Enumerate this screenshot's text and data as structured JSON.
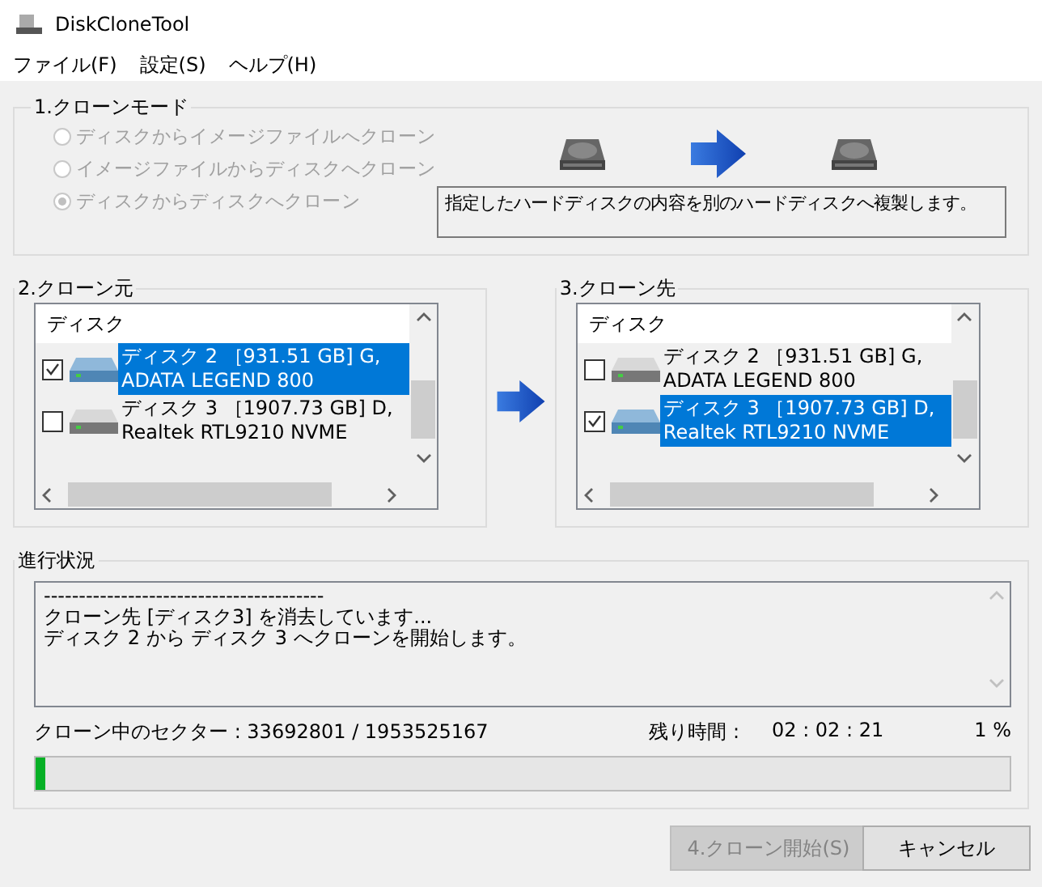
{
  "window": {
    "title": "DiskCloneTool"
  },
  "menu": [
    "ファイル(F)",
    "設定(S)",
    "ヘルプ(H)"
  ],
  "clone_mode": {
    "title": "1.クローンモード",
    "options": [
      {
        "label": "ディスクからイメージファイルへクローン",
        "selected": false,
        "disabled": true
      },
      {
        "label": "イメージファイルからディスクへクローン",
        "selected": false,
        "disabled": true
      },
      {
        "label": "ディスクからディスクへクローン",
        "selected": true,
        "disabled": true
      }
    ],
    "description": "指定したハードディスクの内容を別のハードディスクへ複製します。"
  },
  "source": {
    "title": "2.クローン元",
    "header": "ディスク",
    "disks": [
      {
        "line1": "ディスク 2 ［931.51 GB] G,",
        "line2": "ADATA LEGEND 800",
        "checked": true,
        "selected": true
      },
      {
        "line1": "ディスク 3 ［1907.73 GB] D,",
        "line2": "Realtek  RTL9210 NVME",
        "checked": false,
        "selected": false
      }
    ]
  },
  "target": {
    "title": "3.クローン先",
    "header": "ディスク",
    "disks": [
      {
        "line1": "ディスク 2 ［931.51 GB] G,",
        "line2": "ADATA LEGEND 800",
        "checked": false,
        "selected": false
      },
      {
        "line1": "ディスク 3 ［1907.73 GB] D,",
        "line2": "Realtek  RTL9210 NVME",
        "checked": true,
        "selected": true
      }
    ]
  },
  "progress": {
    "title": "進行状況",
    "log": [
      "----------------------------------------",
      "クローン先 [ディスク3] を消去しています...",
      "ディスク 2 から ディスク 3 へクローンを開始します。"
    ],
    "sectors": "クローン中のセクター : 33692801 / 1953525167",
    "remaining_label": "残り時間 :",
    "remaining": "02 : 02 : 21",
    "percent": "1 %",
    "level": 0.01
  },
  "buttons": [
    {
      "label": "4.クローン開始(S)",
      "disabled": true
    },
    {
      "label": "キャンセル",
      "disabled": false
    }
  ]
}
